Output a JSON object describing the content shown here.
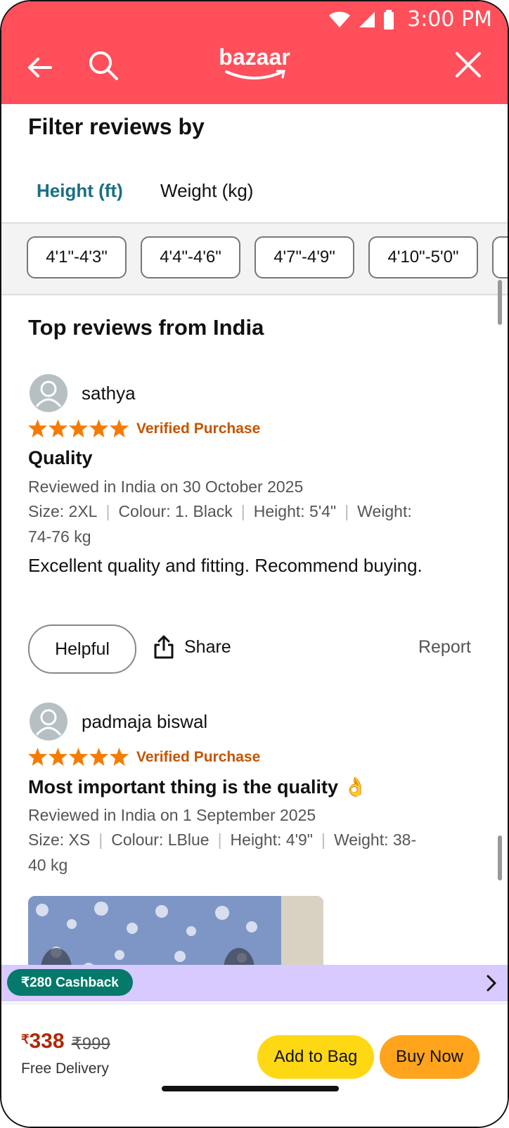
{
  "status": {
    "time": "3:00 PM"
  },
  "app": {
    "logo": "bazaar"
  },
  "filter": {
    "title": "Filter reviews by",
    "tabs": [
      "Height (ft)",
      "Weight (kg)"
    ],
    "chips": [
      "4'1\"-4'3\"",
      "4'4\"-4'6\"",
      "4'7\"-4'9\"",
      "4'10\"-5'0\""
    ]
  },
  "reviews_section": {
    "title": "Top reviews from India"
  },
  "reviews": [
    {
      "name": "sathya",
      "rating": 5,
      "verified": "Verified Purchase",
      "title": "Quality",
      "date": "Reviewed in India on 30 October 2025",
      "size": "Size: 2XL",
      "colour": "Colour: 1. Black",
      "height": "Height: 5'4\"",
      "weight_line1": "Weight:",
      "weight_line2": "74-76 kg",
      "body": "Excellent quality and fitting. Recommend buying.",
      "helpful": "Helpful",
      "share": "Share",
      "report": "Report"
    },
    {
      "name": "padmaja biswal",
      "rating": 5,
      "verified": "Verified Purchase",
      "title": "Most important thing is the quality 👌",
      "date": "Reviewed in India on 1 September 2025",
      "size": "Size: XS",
      "colour": "Colour: LBlue",
      "height": "Height: 4'9\"",
      "weight_line1": "Weight: 38-",
      "weight_line2": "40 kg"
    }
  ],
  "cashback": {
    "label": "₹280 Cashback"
  },
  "purchase": {
    "currency": "₹",
    "price": "338",
    "mrp": "₹999",
    "delivery": "Free Delivery",
    "add_to_bag": "Add to Bag",
    "buy_now": "Buy Now"
  },
  "colors": {
    "header": "#ff4f5a",
    "tab_active": "#1a6e85",
    "verified": "#c45500",
    "cashback_bar": "#d8c9ff",
    "cashback_pill": "#05796a",
    "add_to_bag": "#ffd814",
    "buy_now": "#ffa41c",
    "price": "#b12704"
  }
}
